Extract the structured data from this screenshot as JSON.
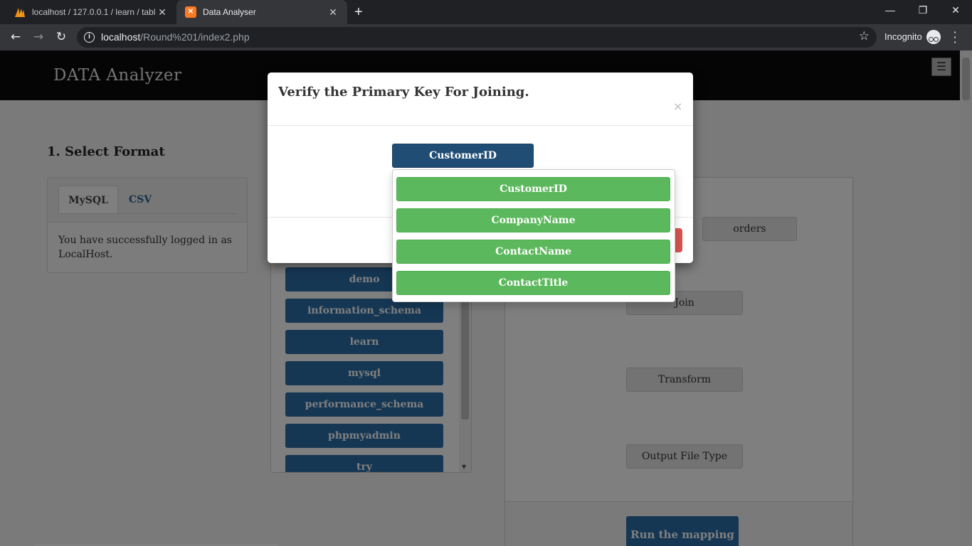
{
  "browser": {
    "tabs": [
      {
        "title": "localhost / 127.0.0.1 / learn / tabl",
        "active": false
      },
      {
        "title": "Data Analyser",
        "active": true
      }
    ],
    "new_tab_glyph": "+",
    "url_host": "localhost",
    "url_path": "/Round%201/index2.php",
    "profile_label": "Incognito",
    "icons": [
      "back-icon",
      "forward-icon",
      "reload-icon",
      "info-icon",
      "star-icon",
      "incognito-icon",
      "menu-icon"
    ]
  },
  "site": {
    "brand": "DATA Analyzer",
    "menu_glyph": "☰"
  },
  "format_section": {
    "title": "1. Select Format",
    "tabs": [
      "MySQL",
      "CSV"
    ],
    "message": "You have successfully logged in as LocalHost."
  },
  "databases": [
    "demo",
    "information_schema",
    "learn",
    "mysql",
    "performance_schema",
    "phpmyadmin",
    "try"
  ],
  "mapping": {
    "table_button": "orders",
    "steps": [
      "Join",
      "Transform",
      "Output File Type"
    ],
    "run_button": "Run the mapping"
  },
  "modal": {
    "title": "Verify the Primary Key For Joining.",
    "close_glyph": "×",
    "selected_key": "CustomerID",
    "options": [
      "CustomerID",
      "CompanyName",
      "ContactName",
      "ContactTitle"
    ]
  },
  "colors": {
    "primary": "#2a6ea8",
    "primary_dark": "#204d74",
    "success": "#5cb85c",
    "danger": "#d9534f",
    "header": "#0b0b0b"
  }
}
